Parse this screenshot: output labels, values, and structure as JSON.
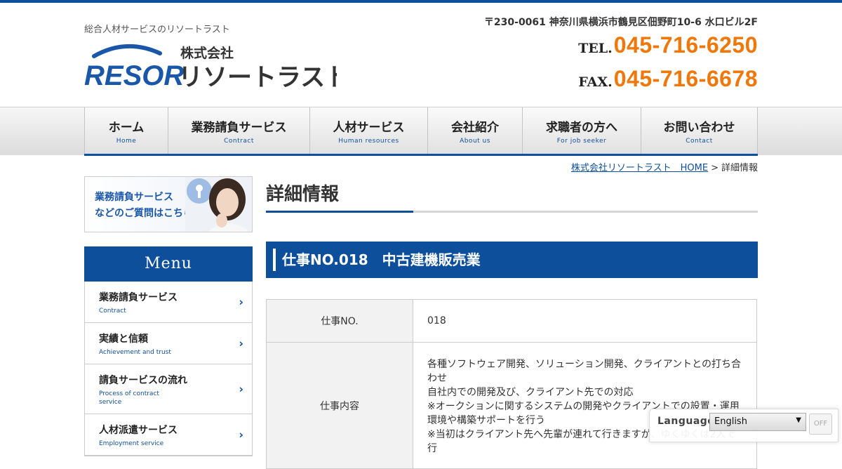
{
  "colors": {
    "brand_blue": "#0e4f9c",
    "phone_orange": "#f0780a",
    "nav_bg": "#e6e6e6"
  },
  "header": {
    "tagline": "総合人材サービスのリソートラスト",
    "logo": {
      "mark": "RESOR",
      "company_type": "株式会社",
      "company_name": "リソートラスト"
    },
    "address": "〒230-0061 神奈川県横浜市鶴見区佃野町10-6 水口ビル2F",
    "tel_label": "TEL.",
    "tel_number": "045-716-6250",
    "fax_label": "FAX.",
    "fax_number": "045-716-6678"
  },
  "nav": [
    {
      "jp": "ホーム",
      "en": "Home"
    },
    {
      "jp": "業務請負サービス",
      "en": "Contract"
    },
    {
      "jp": "人材サービス",
      "en": "Human resources"
    },
    {
      "jp": "会社紹介",
      "en": "About us"
    },
    {
      "jp": "求職者の方へ",
      "en": "For job seeker"
    },
    {
      "jp": "お問い合わせ",
      "en": "Contact"
    }
  ],
  "breadcrumb": {
    "home": "株式会社リソートラスト　HOME",
    "separator": ">",
    "current": "詳細情報"
  },
  "sidebar": {
    "banner_line1": "業務請負サービス",
    "banner_line2": "などのご質問はこちら",
    "menu_title": "Menu",
    "menu": [
      {
        "jp": "業務請負サービス",
        "en": "Contract"
      },
      {
        "jp": "実績と信頼",
        "en": "Achievement and trust"
      },
      {
        "jp": "請負サービスの流れ",
        "en": "Process of contract service"
      },
      {
        "jp": "人材派遣サービス",
        "en": "Employment service"
      }
    ]
  },
  "main": {
    "page_title": "詳細情報",
    "job_heading": "仕事NO.018　中古建機販売業",
    "table": {
      "row1_label": "仕事NO.",
      "row1_value": "018",
      "row2_label": "仕事内容",
      "row2_lines": [
        "各種ソフトウェア開発、ソリューション開発、クライアントとの打ち合わせ",
        "自社内での開発及び、クライアント先での対応",
        "※オークションに関するシステムの開発やクライアントでの設置・運用環境や構築サポートを行う",
        "※当初はクライアント先へ先輩が連れて行きますが、ゆくゆくは2人で行"
      ]
    }
  },
  "language_widget": {
    "label": "Language",
    "selected": "English",
    "toggle": "OFF"
  }
}
